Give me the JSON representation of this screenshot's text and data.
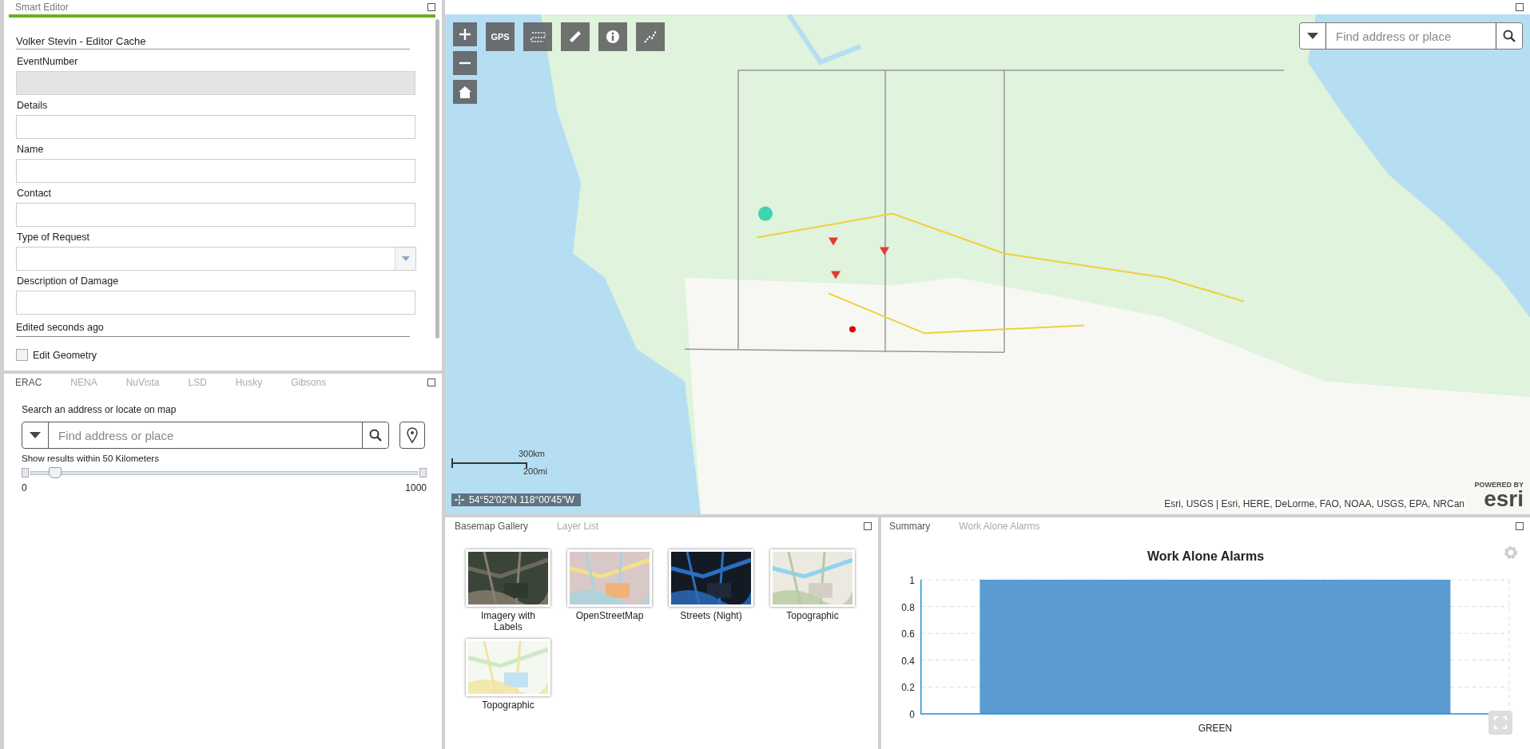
{
  "editor_panel": {
    "title": "Smart Editor",
    "form_title": "Volker Stevin - Editor Cache",
    "fields": [
      {
        "label": "EventNumber",
        "kind": "text",
        "disabled": true
      },
      {
        "label": "Details",
        "kind": "text",
        "disabled": false
      },
      {
        "label": "Name",
        "kind": "text",
        "disabled": false
      },
      {
        "label": "Contact",
        "kind": "text",
        "disabled": false
      },
      {
        "label": "Type of Request",
        "kind": "select",
        "disabled": false
      },
      {
        "label": "Description of Damage",
        "kind": "text",
        "disabled": false
      }
    ],
    "status": "Edited seconds ago",
    "edit_geometry": {
      "label": "Edit Geometry",
      "checked": false
    }
  },
  "search_panel": {
    "tabs": [
      {
        "label": "ERAC",
        "selected": true
      },
      {
        "label": "NENA",
        "selected": false
      },
      {
        "label": "NuVista",
        "selected": false
      },
      {
        "label": "LSD",
        "selected": false
      },
      {
        "label": "Husky",
        "selected": false
      },
      {
        "label": "Gibsons",
        "selected": false
      }
    ],
    "prompt": "Search an address or locate on map",
    "search": {
      "placeholder": "Find address or place"
    },
    "radius_label": "Show results within 50 Kilometers",
    "slider": {
      "level": 0.05,
      "min_label": "0",
      "max_label": "1000"
    }
  },
  "map": {
    "toolbar": [
      {
        "kind": "gps",
        "label": "GPS"
      },
      {
        "kind": "route"
      },
      {
        "kind": "measure"
      },
      {
        "kind": "info"
      },
      {
        "kind": "draw"
      }
    ],
    "search": {
      "placeholder": "Find address or place"
    },
    "scale": {
      "metric": "300km",
      "imperial": "200mi"
    },
    "coordinates": "54°52′02″N 118°00′45″W",
    "attribution": "Esri, USGS | Esri, HERE, DeLorme, FAO, NOAA, USGS, EPA, NRCan",
    "logo": {
      "top": "POWERED BY",
      "word": "esri"
    }
  },
  "basemap_panel": {
    "tabs": [
      {
        "label": "Basemap Gallery",
        "selected": true
      },
      {
        "label": "Layer List",
        "selected": false
      }
    ],
    "basemaps": [
      {
        "label": "Imagery with Labels",
        "kind": "imagery"
      },
      {
        "label": "OpenStreetMap",
        "kind": "streets"
      },
      {
        "label": "Streets (Night)",
        "kind": "night"
      },
      {
        "label": "Topographic",
        "kind": "topo"
      },
      {
        "label": "Topographic",
        "kind": "topo-light"
      }
    ]
  },
  "chart_panel": {
    "tabs": [
      {
        "label": "Summary",
        "selected": true
      },
      {
        "label": "Work Alone Alarms",
        "selected": false
      }
    ],
    "chart_data": {
      "type": "bar",
      "title": "Work Alone Alarms",
      "categories": [
        "GREEN"
      ],
      "values": [
        1
      ],
      "ylim": [
        0,
        1
      ],
      "yticks": [
        0,
        0.2,
        0.4,
        0.6,
        0.8,
        1
      ],
      "grid": true
    }
  }
}
